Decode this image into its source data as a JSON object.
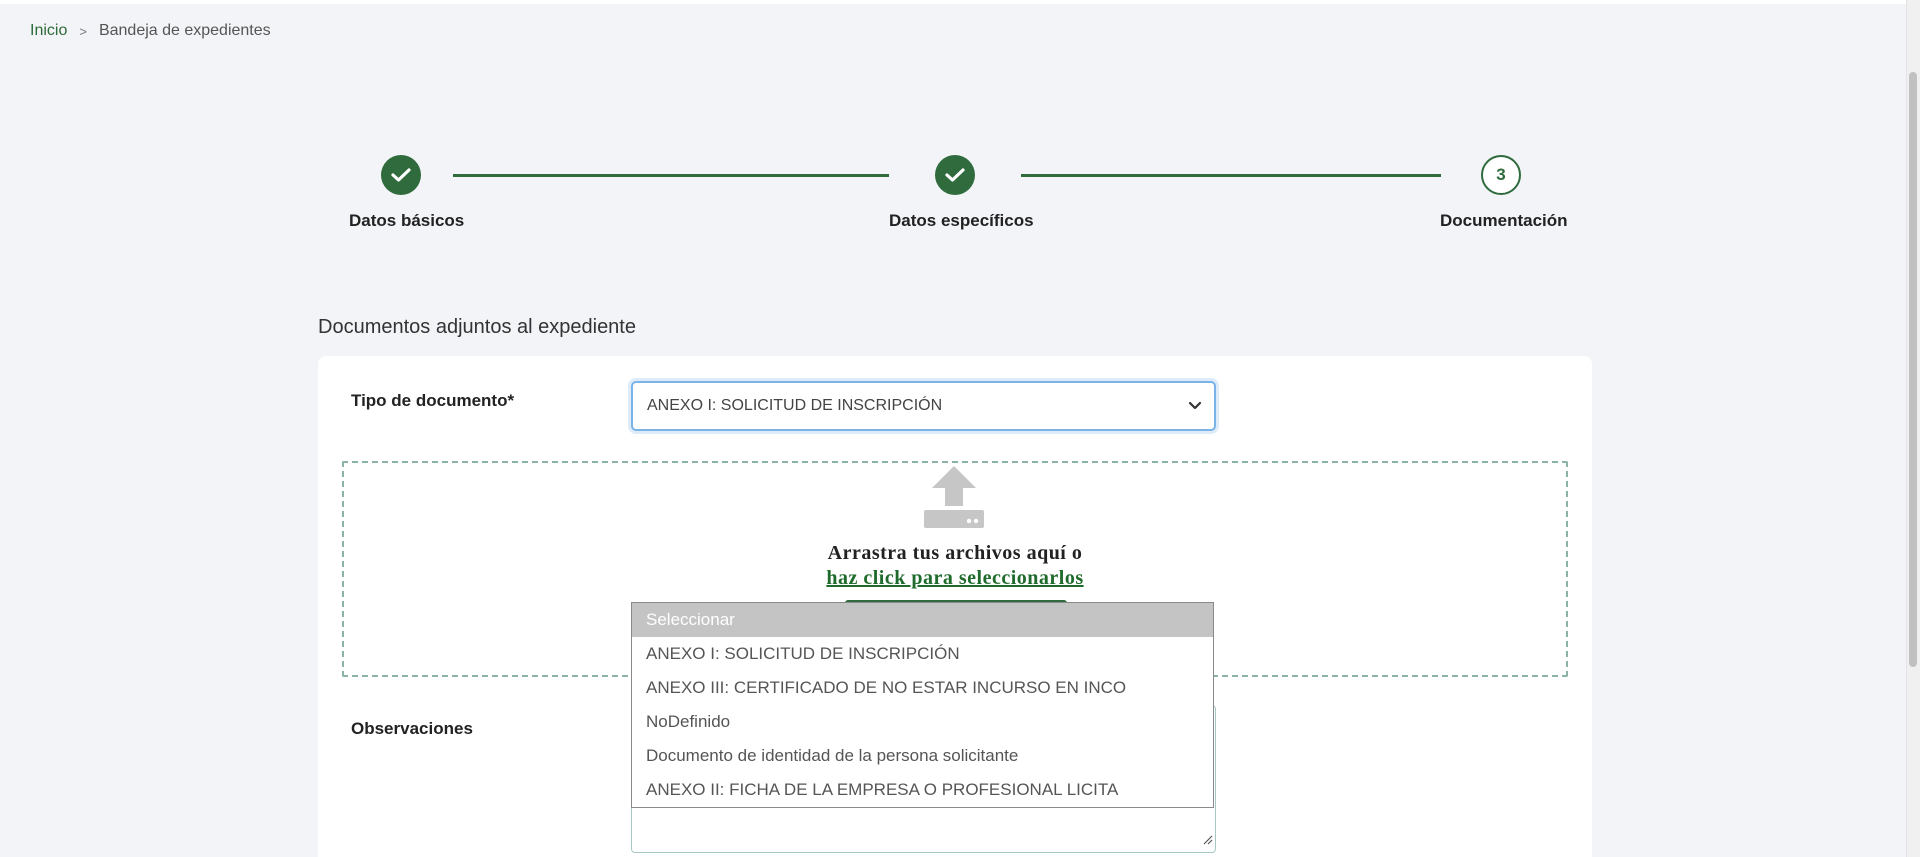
{
  "breadcrumb": {
    "home": "Inicio",
    "separator": ">",
    "current": "Bandeja de expedientes"
  },
  "stepper": {
    "steps": [
      {
        "label": "Datos básicos",
        "status": "completed",
        "icon": "check-icon"
      },
      {
        "label": "Datos específicos",
        "status": "completed",
        "icon": "check-icon"
      },
      {
        "label": "Documentación",
        "status": "current",
        "number": "3"
      }
    ],
    "accent": "#2f6b3d"
  },
  "section": {
    "title": "Documentos adjuntos al expediente"
  },
  "form": {
    "document_type_label": "Tipo de documento*",
    "document_type_value": "ANEXO I: SOLICITUD DE INSCRIPCIÓN",
    "observations_label": "Observaciones"
  },
  "dropzone": {
    "icon": "upload-icon",
    "text": "Arrastra tus archivos aquí o",
    "link_text": "haz click para seleccionarlos"
  },
  "dropdown": {
    "options": [
      "Seleccionar",
      "ANEXO I: SOLICITUD DE INSCRIPCIÓN",
      "ANEXO III: CERTIFICADO DE NO ESTAR INCURSO EN INCO",
      "NoDefinido",
      "Documento de identidad de la persona solicitante",
      "ANEXO II: FICHA DE LA EMPRESA O PROFESIONAL LICITA"
    ],
    "highlighted_index": 0
  }
}
